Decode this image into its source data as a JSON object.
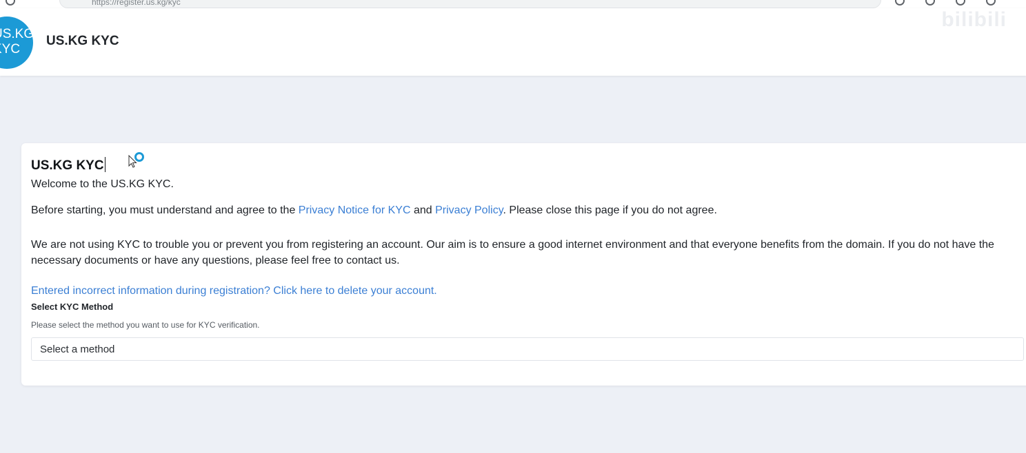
{
  "browser": {
    "url": "https://register.us.kg/kyc"
  },
  "header": {
    "logo_text": "US.KG KYC",
    "title": "US.KG KYC",
    "watermark": "bilibili"
  },
  "card": {
    "title": "US.KG KYC",
    "welcome": "Welcome to the US.KG KYC.",
    "agree_prefix": "Before starting, you must understand and agree to the ",
    "privacy_notice_link": "Privacy Notice for KYC",
    "agree_and": " and ",
    "privacy_policy_link": "Privacy Policy",
    "agree_suffix": ". Please close this page if you do not agree.",
    "aim": "We are not using KYC to trouble you or prevent you from registering an account. Our aim is to ensure a good internet environment and that everyone benefits from the domain. If you do not have the necessary documents or have any questions, please feel free to contact us.",
    "delete_link": "Entered incorrect information during registration? Click here to delete your account.",
    "method_label": "Select KYC Method",
    "method_help": "Please select the method you want to use for KYC verification.",
    "method_selected": "Select a method"
  },
  "colors": {
    "accent": "#1c9ad6",
    "link": "#3b7fd4",
    "background": "#edf0f6"
  },
  "icons": {
    "cursor": "mouse-pointer-icon",
    "loading": "loading-spinner-icon"
  }
}
